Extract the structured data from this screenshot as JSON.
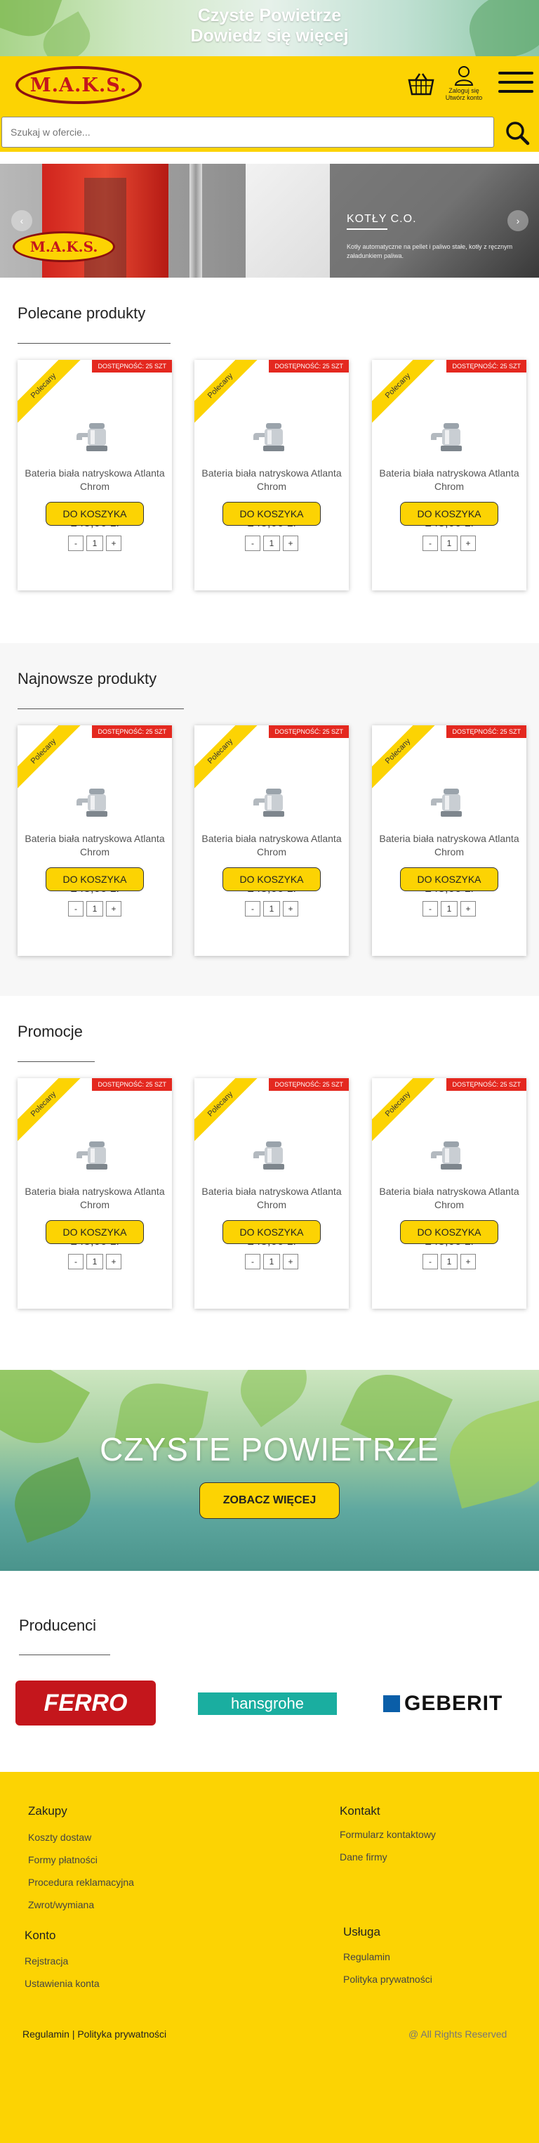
{
  "promo": {
    "line1": "Czyste Powietrze",
    "line2": "Dowiedz się więcej"
  },
  "header": {
    "logo_text": "M.A.K.S.",
    "account_line1": "Zaloguj się",
    "account_line2": "Utwórz konto"
  },
  "search": {
    "placeholder": "Szukaj w ofercie..."
  },
  "hero": {
    "logo_text": "M.A.K.S.",
    "title": "KOTŁY C.O.",
    "description": "Kotły automatyczne na pellet i paliwo stałe, kotły z ręcznym załadunkiem paliwa.",
    "prev": "‹",
    "next": "›"
  },
  "sections": [
    {
      "title": "Polecane produkty",
      "products": [
        {
          "badge": "Polecany",
          "availability": "DOSTĘPNOŚĆ: 25 SZT",
          "name": "Bateria biała natryskowa Atlanta Chrom",
          "price": "248,00 zł",
          "qty": "1",
          "minus": "-",
          "plus": "+",
          "button": "DO KOSZYKA"
        },
        {
          "badge": "Polecany",
          "availability": "DOSTĘPNOŚĆ: 25 SZT",
          "name": "Bateria biała natryskowa Atlanta Chrom",
          "price": "248,00 zł",
          "qty": "1",
          "minus": "-",
          "plus": "+",
          "button": "DO KOSZYKA"
        },
        {
          "badge": "Polecany",
          "availability": "DOSTĘPNOŚĆ: 25 SZT",
          "name": "Bateria biała natryskowa Atlanta Chrom",
          "price": "248,00 zł",
          "qty": "1",
          "minus": "-",
          "plus": "+",
          "button": "DO KOSZYKA"
        }
      ]
    },
    {
      "title": "Najnowsze produkty",
      "products": [
        {
          "badge": "Polecany",
          "availability": "DOSTĘPNOŚĆ: 25 SZT",
          "name": "Bateria biała natryskowa Atlanta Chrom",
          "price": "248,00 zł",
          "qty": "1",
          "minus": "-",
          "plus": "+",
          "button": "DO KOSZYKA"
        },
        {
          "badge": "Polecany",
          "availability": "DOSTĘPNOŚĆ: 25 SZT",
          "name": "Bateria biała natryskowa Atlanta Chrom",
          "price": "248,00 zł",
          "qty": "1",
          "minus": "-",
          "plus": "+",
          "button": "DO KOSZYKA"
        },
        {
          "badge": "Polecany",
          "availability": "DOSTĘPNOŚĆ: 25 SZT",
          "name": "Bateria biała natryskowa Atlanta Chrom",
          "price": "248,00 zł",
          "qty": "1",
          "minus": "-",
          "plus": "+",
          "button": "DO KOSZYKA"
        }
      ]
    },
    {
      "title": "Promocje",
      "products": [
        {
          "badge": "Polecany",
          "availability": "DOSTĘPNOŚĆ: 25 SZT",
          "name": "Bateria biała natryskowa Atlanta Chrom",
          "price": "248,00 zł",
          "qty": "1",
          "minus": "-",
          "plus": "+",
          "button": "DO KOSZYKA"
        },
        {
          "badge": "Polecany",
          "availability": "DOSTĘPNOŚĆ: 25 SZT",
          "name": "Bateria biała natryskowa Atlanta Chrom",
          "price": "248,00 zł",
          "qty": "1",
          "minus": "-",
          "plus": "+",
          "button": "DO KOSZYKA"
        },
        {
          "badge": "Polecany",
          "availability": "DOSTĘPNOŚĆ: 25 SZT",
          "name": "Bateria biała natryskowa Atlanta Chrom",
          "price": "248,00 zł",
          "qty": "1",
          "minus": "-",
          "plus": "+",
          "button": "DO KOSZYKA"
        }
      ]
    }
  ],
  "air_banner": {
    "title": "CZYSTE POWIETRZE",
    "button": "ZOBACZ WIĘCEJ"
  },
  "producers": {
    "title": "Producenci",
    "brands": [
      "FERRO",
      "hansgrohe",
      "GEBERIT"
    ]
  },
  "footer": {
    "zakupy": {
      "title": "Zakupy",
      "links": [
        "Koszty dostaw",
        "Formy płatności",
        "Procedura reklamacyjna",
        "Zwrot/wymiana"
      ]
    },
    "kontakt": {
      "title": "Kontakt",
      "links": [
        "Formularz kontaktowy",
        "Dane firmy"
      ]
    },
    "konto": {
      "title": "Konto",
      "links": [
        "Rejstracja",
        "Ustawienia konta"
      ]
    },
    "usluga": {
      "title": "Usługa",
      "links": [
        "Regulamin",
        "Polityka prywatności"
      ]
    },
    "bottom_links": "Regulamin | Polityka prywatności",
    "copyright": "@ All Rights Reserved"
  },
  "colors": {
    "brand_yellow": "#fcd303",
    "badge_red": "#e4281f",
    "logo_red": "#c4161c"
  },
  "icons": [
    "basket-icon",
    "user-icon",
    "hamburger-icon",
    "search-icon",
    "faucet-icon"
  ]
}
